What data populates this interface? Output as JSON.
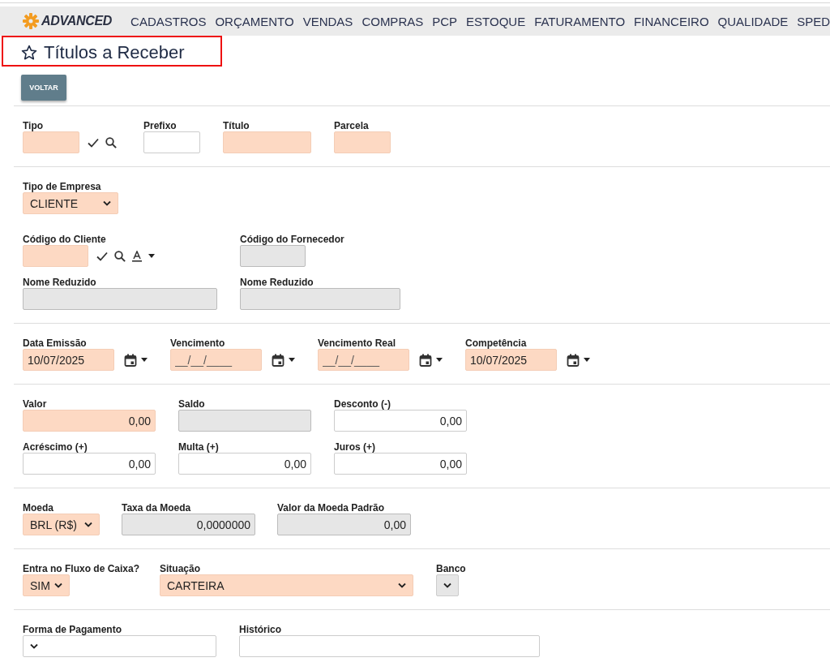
{
  "header": {
    "logo": "ADVANCED",
    "menu": [
      "CADASTROS",
      "ORÇAMENTO",
      "VENDAS",
      "COMPRAS",
      "PCP",
      "ESTOQUE",
      "FATURAMENTO",
      "FINANCEIRO",
      "QUALIDADE",
      "SPED"
    ]
  },
  "page": {
    "title": "Títulos a Receber",
    "favorite": false,
    "highlighted": true
  },
  "buttons": [
    "VOLTAR"
  ],
  "sections": [
    {
      "rows": [
        {
          "fields": [
            {
              "label": "Tipo",
              "kind": "lookup",
              "required": true,
              "disabled": false
            },
            {
              "label": "Prefixo",
              "kind": "text",
              "required": false,
              "disabled": false
            },
            {
              "label": "Título",
              "kind": "text",
              "required": true,
              "disabled": false
            },
            {
              "label": "Parcela",
              "kind": "text",
              "required": true,
              "disabled": false
            }
          ]
        }
      ]
    },
    {
      "rows": [
        {
          "fields": [
            {
              "label": "Tipo de Empresa",
              "kind": "select",
              "value": "CLIENTE",
              "required": true,
              "disabled": false
            }
          ]
        },
        {
          "fields": [
            {
              "label": "Código do Cliente",
              "kind": "lookup_filter",
              "required": true,
              "disabled": false
            },
            {
              "label": "Código do Fornecedor",
              "kind": "text",
              "required": false,
              "disabled": true
            }
          ]
        },
        {
          "fields": [
            {
              "label": "Nome Reduzido",
              "kind": "text",
              "required": false,
              "disabled": true
            },
            {
              "label": "Nome Reduzido",
              "kind": "text",
              "required": false,
              "disabled": true
            }
          ]
        }
      ]
    },
    {
      "rows": [
        {
          "fields": [
            {
              "label": "Data Emissão",
              "kind": "date",
              "value": "10/07/2025",
              "required": true,
              "disabled": false
            },
            {
              "label": "Vencimento",
              "kind": "date",
              "placeholder": "__/__/____",
              "required": true,
              "disabled": false
            },
            {
              "label": "Vencimento Real",
              "kind": "date",
              "placeholder": "__/__/____",
              "required": true,
              "disabled": false
            },
            {
              "label": "Competência",
              "kind": "date",
              "value": "10/07/2025",
              "required": true,
              "disabled": false
            }
          ]
        }
      ]
    },
    {
      "rows": [
        {
          "fields": [
            {
              "label": "Valor",
              "kind": "number",
              "value": "0,00",
              "required": true,
              "disabled": false
            },
            {
              "label": "Saldo",
              "kind": "number",
              "required": false,
              "disabled": true
            },
            {
              "label": "Desconto (-)",
              "kind": "number",
              "value": "0,00",
              "required": false,
              "disabled": false
            }
          ]
        },
        {
          "fields": [
            {
              "label": "Acréscimo (+)",
              "kind": "number",
              "value": "0,00",
              "required": false,
              "disabled": false
            },
            {
              "label": "Multa (+)",
              "kind": "number",
              "value": "0,00",
              "required": false,
              "disabled": false
            },
            {
              "label": "Juros (+)",
              "kind": "number",
              "value": "0,00",
              "required": false,
              "disabled": false
            }
          ]
        }
      ]
    },
    {
      "rows": [
        {
          "fields": [
            {
              "label": "Moeda",
              "kind": "select",
              "value": "BRL (R$)",
              "required": true,
              "disabled": false
            },
            {
              "label": "Taxa da Moeda",
              "kind": "number",
              "value": "0,0000000",
              "required": false,
              "disabled": true
            },
            {
              "label": "Valor da Moeda Padrão",
              "kind": "number",
              "value": "0,00",
              "required": false,
              "disabled": true
            }
          ]
        }
      ]
    },
    {
      "rows": [
        {
          "fields": [
            {
              "label": "Entra no Fluxo de Caixa?",
              "kind": "select",
              "value": "SIM",
              "required": true,
              "disabled": false
            },
            {
              "label": "Situação",
              "kind": "select",
              "value": "CARTEIRA",
              "required": true,
              "disabled": false
            },
            {
              "label": "Banco",
              "kind": "select",
              "required": false,
              "disabled": true
            }
          ]
        }
      ]
    },
    {
      "rows": [
        {
          "fields": [
            {
              "label": "Forma de Pagamento",
              "kind": "select",
              "required": false,
              "disabled": false
            },
            {
              "label": "Histórico",
              "kind": "text",
              "required": false,
              "disabled": false
            }
          ]
        }
      ]
    }
  ]
}
